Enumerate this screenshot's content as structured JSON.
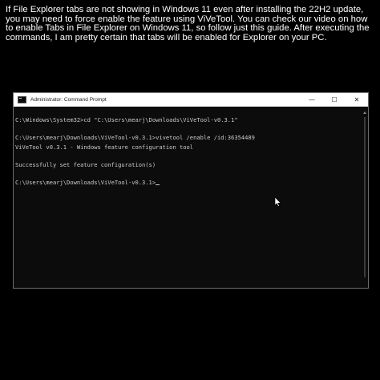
{
  "caption": {
    "text": "If File Explorer tabs are not showing in Windows 11 even after installing the 22H2 update, you may need to force enable the feature using ViVeTool. You can check our video on how to enable Tabs in File Explorer on Windows 11, so follow just this guide. After executing the commands, I am pretty certain that tabs will be enabled for Explorer on your PC."
  },
  "window": {
    "title": "Administrator: Command Prompt",
    "controls": {
      "minimize": "—",
      "maximize": "☐",
      "close": "✕"
    }
  },
  "console": {
    "lines": [
      "C:\\Windows\\System32>cd \"C:\\Users\\mearj\\Downloads\\ViVeTool-v0.3.1\"",
      "",
      "C:\\Users\\mearj\\Downloads\\ViVeTool-v0.3.1>vivetool /enable /id:36354489",
      "ViVeTool v0.3.1 - Windows feature configuration tool",
      "",
      "Successfully set feature configuration(s)",
      "",
      "C:\\Users\\mearj\\Downloads\\ViVeTool-v0.3.1>"
    ]
  },
  "colors": {
    "background": "#000000",
    "console_bg": "#0c0c0c",
    "console_text": "#cccccc",
    "titlebar_bg": "#ffffff"
  },
  "icons": {
    "app": "command-prompt-icon",
    "pointer": "mouse-pointer-icon"
  }
}
